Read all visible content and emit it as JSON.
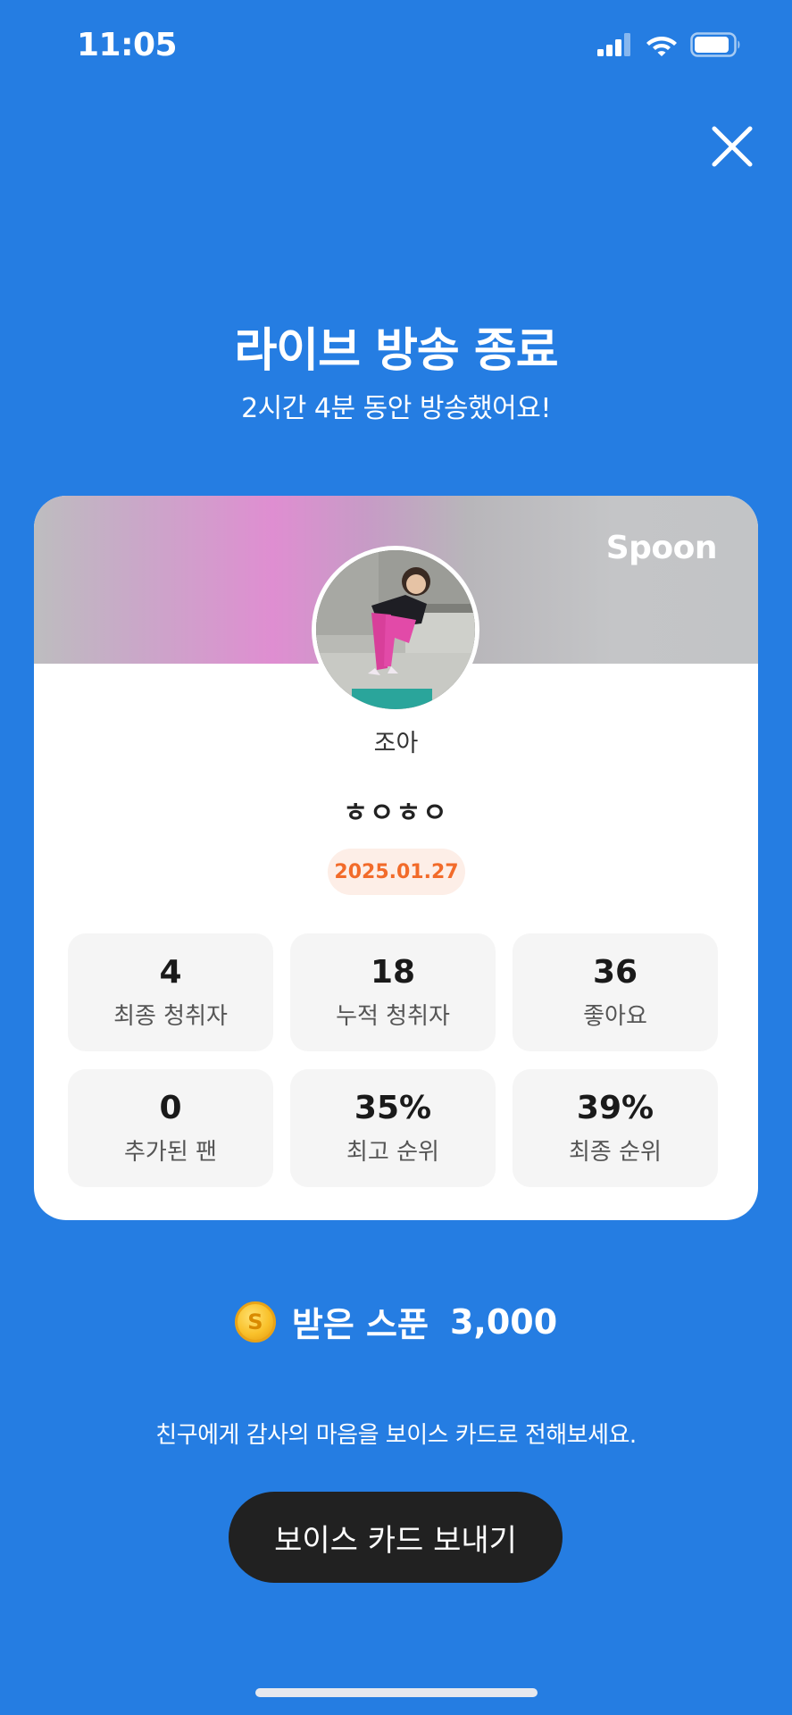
{
  "status_bar": {
    "time": "11:05",
    "icons": [
      "cellular-signal-icon",
      "wifi-icon",
      "battery-icon"
    ]
  },
  "header": {
    "close_icon": "close-icon",
    "title": "라이브 방송 종료",
    "subtitle": "2시간 4분 동안 방송했어요!"
  },
  "card": {
    "brand": "Spoon",
    "username": "조아",
    "broadcast_title": "ㅎㅇㅎㅇ",
    "date": "2025.01.27",
    "stats": [
      {
        "value": "4",
        "label": "최종 청취자"
      },
      {
        "value": "18",
        "label": "누적 청취자"
      },
      {
        "value": "36",
        "label": "좋아요"
      },
      {
        "value": "0",
        "label": "추가된 팬"
      },
      {
        "value": "35%",
        "label": "최고 순위"
      },
      {
        "value": "39%",
        "label": "최종 순위"
      }
    ]
  },
  "spoons": {
    "coin_letter": "S",
    "label": "받은 스푼",
    "value": "3,000"
  },
  "footer": {
    "hint": "친구에게 감사의 마음을 보이스 카드로 전해보세요.",
    "button_label": "보이스 카드 보내기"
  },
  "colors": {
    "background": "#257de2",
    "button": "#212121",
    "date_badge_text": "#f26b2a",
    "date_badge_bg": "#fdeee7"
  }
}
